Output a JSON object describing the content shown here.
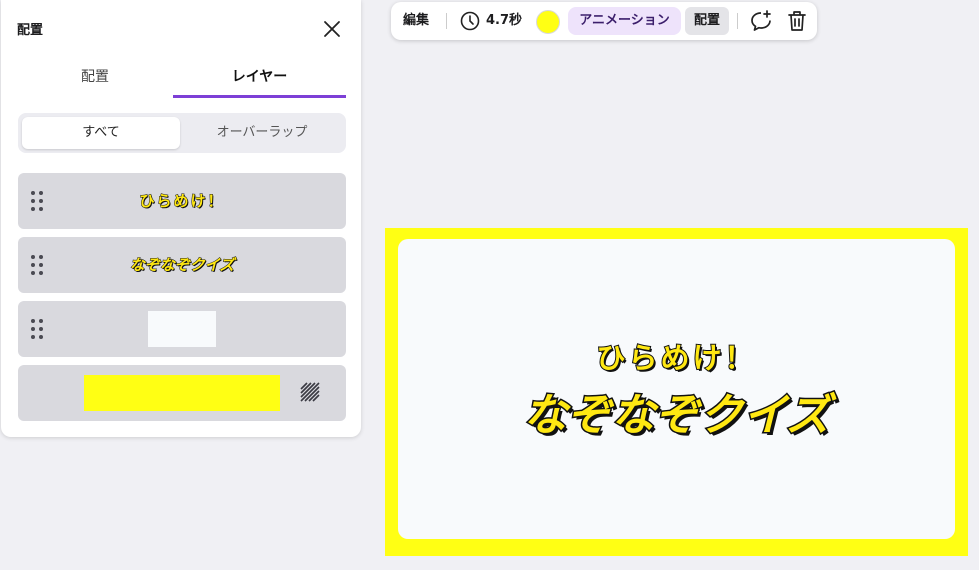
{
  "panel": {
    "title": "配置",
    "tabs": [
      {
        "label": "配置"
      },
      {
        "label": "レイヤー"
      }
    ],
    "segment": [
      {
        "label": "すべて"
      },
      {
        "label": "オーバーラップ"
      }
    ],
    "layers": [
      {
        "text": "ひらめけ！"
      },
      {
        "text": "なぞなぞクイズ"
      }
    ]
  },
  "toolbar": {
    "edit_label": "編集",
    "duration": "4.7秒",
    "animation_label": "アニメーション",
    "arrange_label": "配置"
  },
  "canvas": {
    "subtitle": "ひらめけ！",
    "title": "なぞなぞクイズ"
  },
  "colors": {
    "accent": "#7d3fd6",
    "brand_yellow": "#ffff14",
    "text_yellow": "#ffe812",
    "card_bg": "#f8fafc"
  },
  "icons": [
    "close-icon",
    "drag-handle-icon",
    "lock-icon",
    "clock-icon",
    "comment-add-icon",
    "trash-icon"
  ]
}
